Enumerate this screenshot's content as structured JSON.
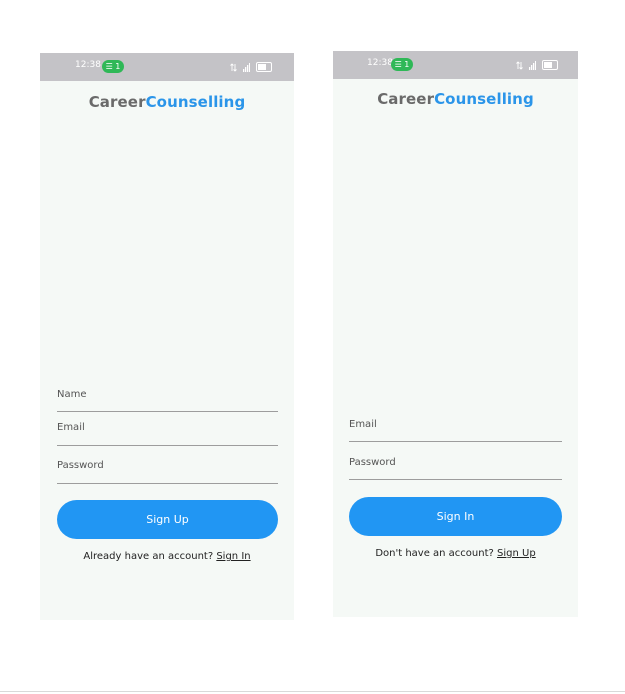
{
  "signup": {
    "status": {
      "time": "12:38",
      "pill": "☰ 1"
    },
    "brand": {
      "part1": "Career",
      "part2": "Counselling"
    },
    "fields": {
      "name": "Name",
      "email": "Email",
      "password": "Password"
    },
    "button": "Sign Up",
    "prompt": "Already have an account?",
    "link": "Sign In"
  },
  "signin": {
    "status": {
      "time": "12:38",
      "pill": "☰ 1"
    },
    "brand": {
      "part1": "Career",
      "part2": "Counselling"
    },
    "fields": {
      "email": "Email",
      "password": "Password"
    },
    "button": "Sign In",
    "prompt": "Don't have an account?",
    "link": "Sign Up"
  },
  "colors": {
    "accent": "#2196f3",
    "brand_blue": "#2b95e9",
    "status_bar": "#c4c3c7",
    "screen_bg": "#f5f9f6"
  }
}
